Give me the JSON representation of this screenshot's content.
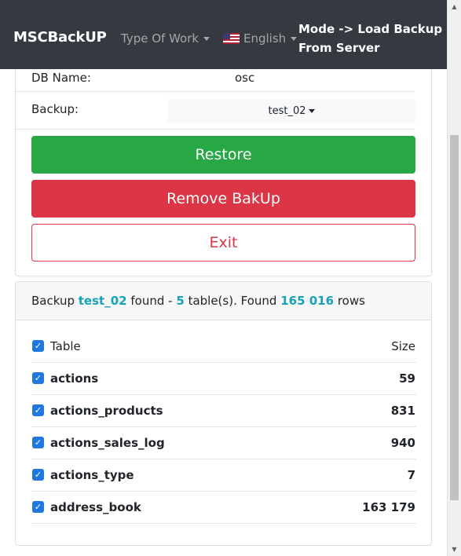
{
  "navbar": {
    "brand": "MSCBackUP",
    "type_of_work": "Type Of Work",
    "language": "English",
    "mode_line1": "Mode -> Load Backup",
    "mode_line2": "From Server"
  },
  "form": {
    "db_name_label": "DB Name:",
    "db_name_value": "osc",
    "backup_label": "Backup:",
    "backup_value": "test_02"
  },
  "buttons": {
    "restore": "Restore",
    "remove": "Remove BakUp",
    "exit": "Exit"
  },
  "summary": {
    "prefix": "Backup",
    "backup_name": "test_02",
    "found_text": "found -",
    "table_count": "5",
    "tables_text": "table(s). Found",
    "row_count": "165 016",
    "rows_text": "rows"
  },
  "table": {
    "header_name": "Table",
    "header_size": "Size",
    "rows": [
      {
        "name": "actions",
        "size": "59"
      },
      {
        "name": "actions_products",
        "size": "831"
      },
      {
        "name": "actions_sales_log",
        "size": "940"
      },
      {
        "name": "actions_type",
        "size": "7"
      },
      {
        "name": "address_book",
        "size": "163 179"
      }
    ]
  },
  "colors": {
    "navbar": "#343a40",
    "success": "#28a745",
    "danger": "#dc3545",
    "info": "#17a2b8",
    "checkbox": "#1f77e0"
  },
  "icons": {
    "checkbox": "checkbox-checked-icon",
    "flag": "us-flag-icon",
    "caret": "caret-down-icon"
  }
}
